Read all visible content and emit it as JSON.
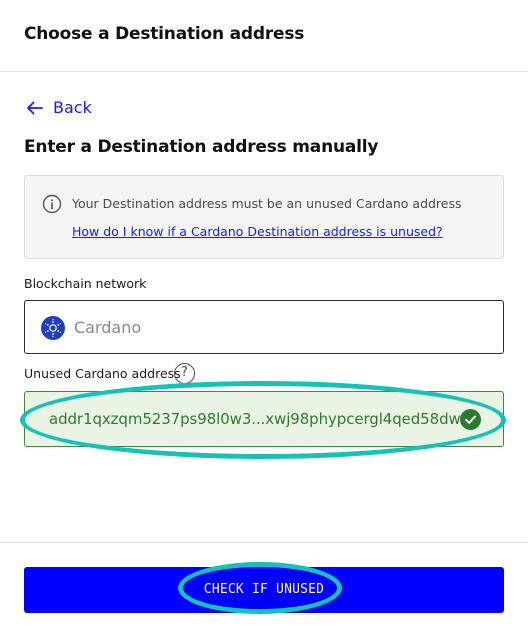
{
  "header": {
    "title": "Choose a Destination address"
  },
  "nav": {
    "back_label": "Back",
    "back_icon": "arrow-left-icon"
  },
  "section": {
    "title": "Enter a Destination address manually"
  },
  "info": {
    "icon": "info-icon",
    "text": "Your Destination address must be an unused Cardano address",
    "link": "How do I know if a Cardano Destination address is unused?"
  },
  "network": {
    "label": "Blockchain network",
    "value": "Cardano",
    "icon": "cardano-logo-icon"
  },
  "address": {
    "label": "Unused Cardano address",
    "help_icon": "question-icon",
    "help_glyph": "?",
    "value": "addr1qxzqm5237ps98l0w3...xwj98phypcergl4qed58dw",
    "status_icon": "check-circle-icon"
  },
  "footer": {
    "button_label": "CHECK IF UNUSED"
  },
  "colors": {
    "accent": "#0000ff",
    "success": "#2c7a2c",
    "success_bg": "#e9f4e4",
    "highlight": "#16c2b4"
  }
}
